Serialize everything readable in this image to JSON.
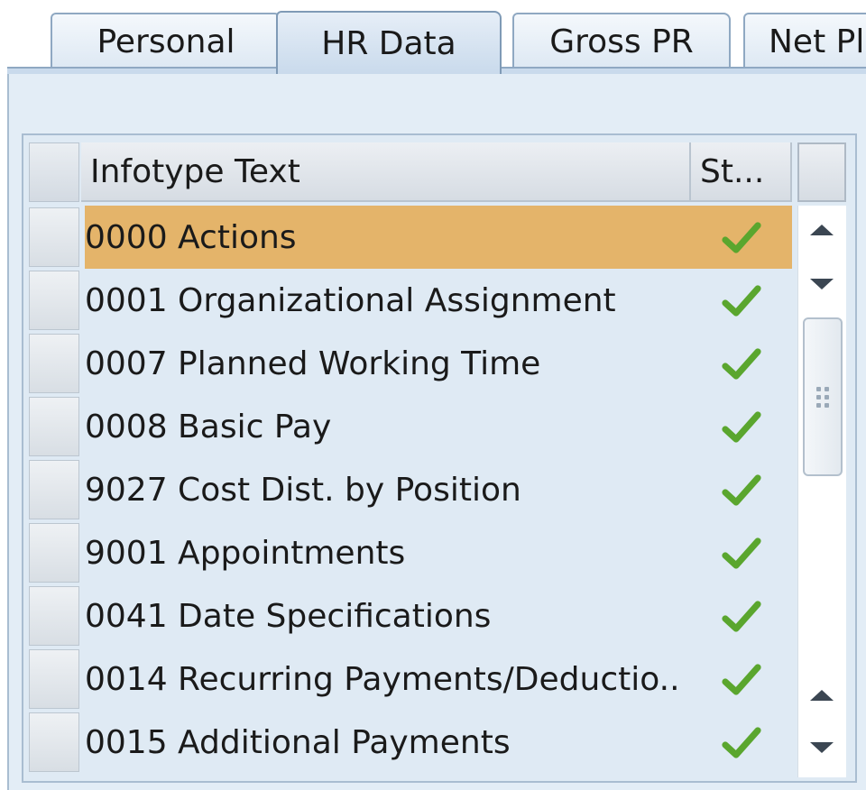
{
  "tabs": [
    {
      "label": "Personal",
      "active": false
    },
    {
      "label": "HR Data",
      "active": true
    },
    {
      "label": "Gross PR",
      "active": false
    },
    {
      "label": "Net Pl",
      "active": false
    }
  ],
  "table": {
    "columns": [
      "Infotype Text",
      "St..."
    ],
    "rows": [
      {
        "text": "0000 Actions",
        "status_icon": "check-icon",
        "selected": true
      },
      {
        "text": "0001 Organizational Assignment",
        "status_icon": "check-icon",
        "selected": false
      },
      {
        "text": "0007 Planned Working Time",
        "status_icon": "check-icon",
        "selected": false
      },
      {
        "text": "0008 Basic Pay",
        "status_icon": "check-icon",
        "selected": false
      },
      {
        "text": "9027 Cost Dist. by Position",
        "status_icon": "check-icon",
        "selected": false
      },
      {
        "text": "9001 Appointments",
        "status_icon": "check-icon",
        "selected": false
      },
      {
        "text": "0041 Date Specifications",
        "status_icon": "check-icon",
        "selected": false
      },
      {
        "text": "0014 Recurring Payments/Deductio..",
        "status_icon": "check-icon",
        "selected": false
      },
      {
        "text": "0015 Additional Payments",
        "status_icon": "check-icon",
        "selected": false
      }
    ]
  },
  "colors": {
    "selected_row": "#e4b46a",
    "check": "#5aa62e",
    "panel": "#e3edf6"
  }
}
